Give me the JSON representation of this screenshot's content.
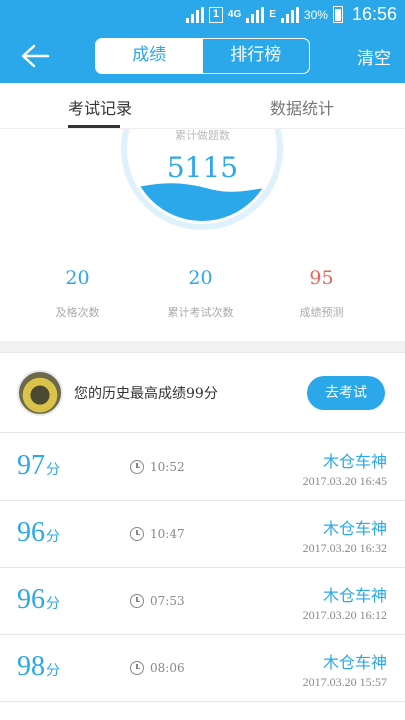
{
  "status_bar": {
    "sim_slot": "1",
    "network": "4G",
    "network2": "E",
    "battery_pct": "30%",
    "time": "16:56"
  },
  "header": {
    "segments": [
      "成绩",
      "排行榜"
    ],
    "active_segment": 0,
    "clear_label": "清空"
  },
  "tabs": [
    "考试记录",
    "数据统计"
  ],
  "summary": {
    "total_questions_label": "累计做题数",
    "total_questions": "5115",
    "stats": [
      {
        "value": "20",
        "label": "及格次数",
        "color": "#2aa8ea"
      },
      {
        "value": "20",
        "label": "累计考试次数",
        "color": "#2aa8ea"
      },
      {
        "value": "95",
        "label": "成绩预测",
        "color": "#e8645a"
      }
    ]
  },
  "best": {
    "text": "您的历史最高成绩99分",
    "button": "去考试"
  },
  "records": [
    {
      "score": "97",
      "unit": "分",
      "duration": "10:52",
      "title": "木仓车神",
      "datetime": "2017.03.20  16:45"
    },
    {
      "score": "96",
      "unit": "分",
      "duration": "10:47",
      "title": "木仓车神",
      "datetime": "2017.03.20  16:32"
    },
    {
      "score": "96",
      "unit": "分",
      "duration": "07:53",
      "title": "木仓车神",
      "datetime": "2017.03.20  16:12"
    },
    {
      "score": "98",
      "unit": "分",
      "duration": "08:06",
      "title": "木仓车神",
      "datetime": "2017.03.20  15:57"
    }
  ],
  "colors": {
    "accent": "#2aa8ea",
    "warning": "#e8645a"
  },
  "icons": {
    "back": "arrow-left-icon",
    "clock": "clock-icon"
  }
}
